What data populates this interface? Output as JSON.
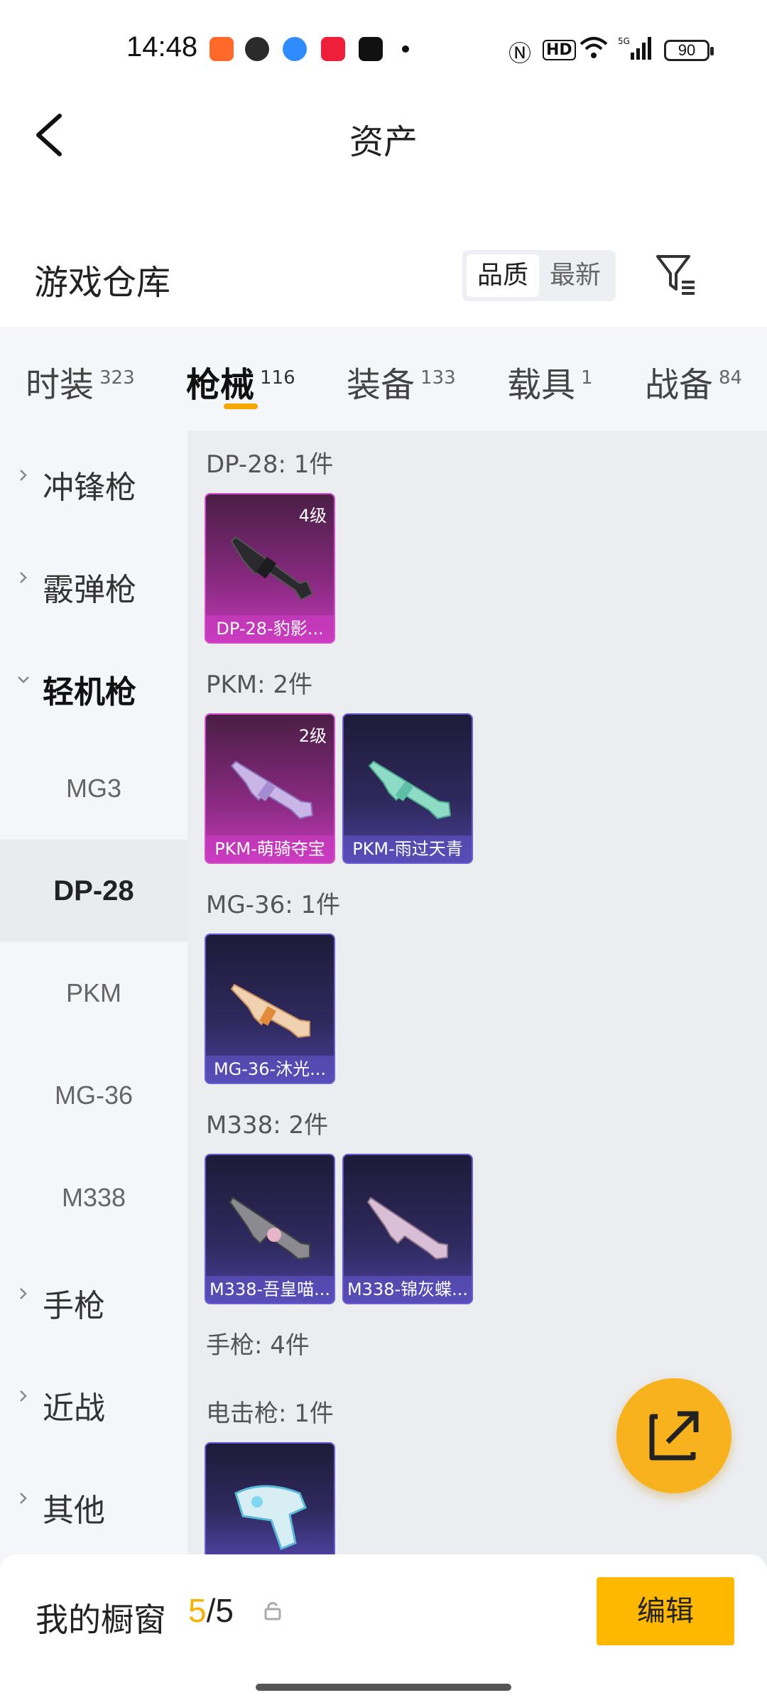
{
  "status_bar": {
    "time": "14:48",
    "battery": "90",
    "icons": [
      "gallery-app-icon",
      "wechat-icon",
      "browser-icon",
      "music-app-icon",
      "tiktok-icon",
      "dot-icon",
      "nfc-icon",
      "hd-icon",
      "wifi-icon",
      "signal-5g-icon"
    ]
  },
  "header": {
    "title": "资产"
  },
  "warehouse": {
    "title": "游戏仓库",
    "sort_options": [
      "品质",
      "最新"
    ],
    "selected_sort": "品质"
  },
  "tabs": [
    {
      "label": "时装",
      "count": "323"
    },
    {
      "label": "枪械",
      "count": "116"
    },
    {
      "label": "装备",
      "count": "133"
    },
    {
      "label": "载具",
      "count": "1"
    },
    {
      "label": "战备",
      "count": "84"
    }
  ],
  "active_tab": "枪械",
  "sidebar": {
    "categories": [
      {
        "label": "冲锋枪"
      },
      {
        "label": "霰弹枪"
      },
      {
        "label": "轻机枪"
      }
    ],
    "subitems": [
      "MG3",
      "DP-28",
      "PKM",
      "MG-36",
      "M338"
    ],
    "active_subitem": "DP-28",
    "more_categories": [
      {
        "label": "手枪"
      },
      {
        "label": "近战"
      },
      {
        "label": "其他"
      }
    ]
  },
  "groups": [
    {
      "title": "DP-28: 1件",
      "items": [
        {
          "name": "DP-28-豹影...",
          "level": "4级",
          "rarity": "purple"
        }
      ]
    },
    {
      "title": "PKM: 2件",
      "items": [
        {
          "name": "PKM-萌骑夺宝",
          "level": "2级",
          "rarity": "purple"
        },
        {
          "name": "PKM-雨过天青",
          "level": "",
          "rarity": "blue"
        }
      ]
    },
    {
      "title": "MG-36: 1件",
      "items": [
        {
          "name": "MG-36-沐光...",
          "level": "",
          "rarity": "blue"
        }
      ]
    },
    {
      "title": "M338: 2件",
      "items": [
        {
          "name": "M338-吾皇喵...",
          "level": "",
          "rarity": "blue"
        },
        {
          "name": "M338-锦灰蝶...",
          "level": "",
          "rarity": "blue"
        }
      ]
    },
    {
      "title": "手枪: 4件",
      "items": []
    },
    {
      "title": "电击枪: 1件",
      "items": [
        {
          "name": "",
          "level": "",
          "rarity": "blue"
        }
      ]
    }
  ],
  "showcase": {
    "title": "我的橱窗",
    "current": "5",
    "separator": "/",
    "total": "5",
    "edit_label": "编辑"
  },
  "colors": {
    "accent": "#ffb800",
    "purple_rarity": "#c23bb8",
    "blue_rarity": "#4b3f9a"
  }
}
